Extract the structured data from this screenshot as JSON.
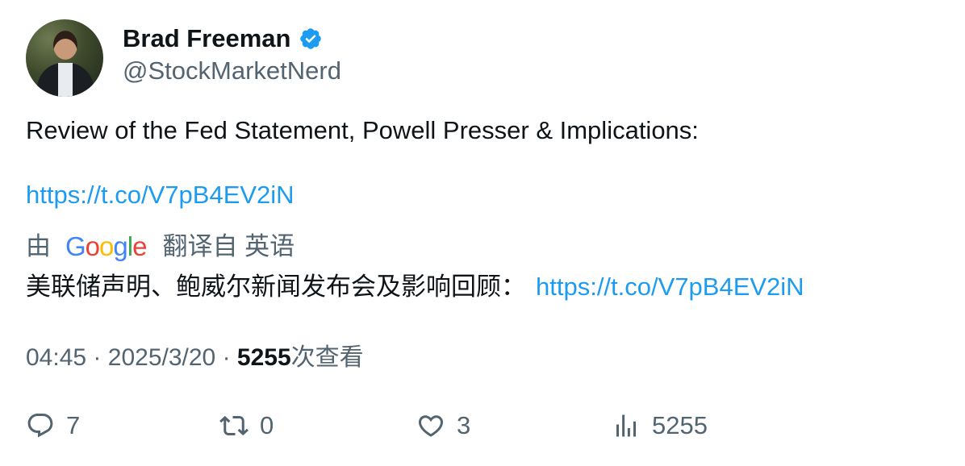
{
  "author": {
    "name": "Brad Freeman",
    "handle": "@StockMarketNerd"
  },
  "tweet": {
    "text": "Review of the Fed Statement, Powell Presser & Implications:",
    "link": "https://t.co/V7pB4EV2iN"
  },
  "translation": {
    "prefix": "由",
    "google": [
      "G",
      "o",
      "o",
      "g",
      "l",
      "e"
    ],
    "suffix": "翻译自 英语",
    "text": "美联储声明、鲍威尔新闻发布会及影响回顾：",
    "link": "https://t.co/V7pB4EV2iN"
  },
  "meta": {
    "time": "04:45",
    "separator": "·",
    "date": "2025/3/20",
    "views_count": "5255",
    "views_label": "次查看"
  },
  "actions": {
    "replies": "7",
    "retweets": "0",
    "likes": "3",
    "views": "5255"
  },
  "colors": {
    "link": "#1d9bf0",
    "secondary": "#536471",
    "verified": "#1d9bf0"
  }
}
